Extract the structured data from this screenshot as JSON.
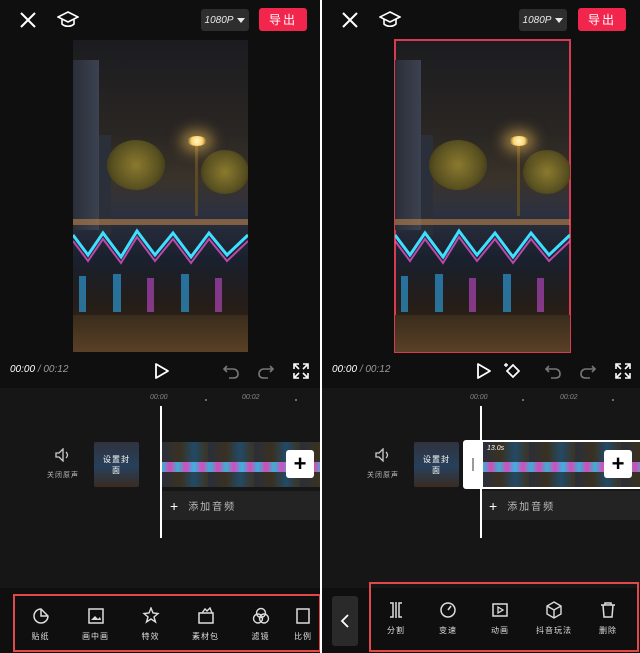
{
  "header": {
    "resolution": "1080P",
    "export_label": "导出"
  },
  "player": {
    "current_time": "00:00",
    "separator": "/",
    "total_time": "00:12"
  },
  "timeline": {
    "ruler_labels": [
      "00:00",
      "00:02"
    ],
    "mute_label": "关闭原声",
    "cover_label": "设置封面",
    "add_audio_label": "添加音频",
    "clip_duration": "13.0s"
  },
  "left_toolbar": [
    {
      "label": "贴纸",
      "icon": "sticker-icon"
    },
    {
      "label": "画中画",
      "icon": "picture-in-picture-icon"
    },
    {
      "label": "特效",
      "icon": "effects-star-icon"
    },
    {
      "label": "素材包",
      "icon": "material-pack-icon"
    },
    {
      "label": "滤镜",
      "icon": "filter-icon"
    },
    {
      "label": "比例",
      "icon": "ratio-icon"
    }
  ],
  "right_toolbar": [
    {
      "label": "分割",
      "icon": "split-icon"
    },
    {
      "label": "变速",
      "icon": "speed-icon"
    },
    {
      "label": "动画",
      "icon": "animation-icon"
    },
    {
      "label": "抖音玩法",
      "icon": "douyin-play-icon"
    },
    {
      "label": "删除",
      "icon": "delete-icon"
    }
  ],
  "colors": {
    "accent_red": "#f2254c",
    "highlight_box": "#e0484a",
    "selection_outline": "#d83a52"
  }
}
